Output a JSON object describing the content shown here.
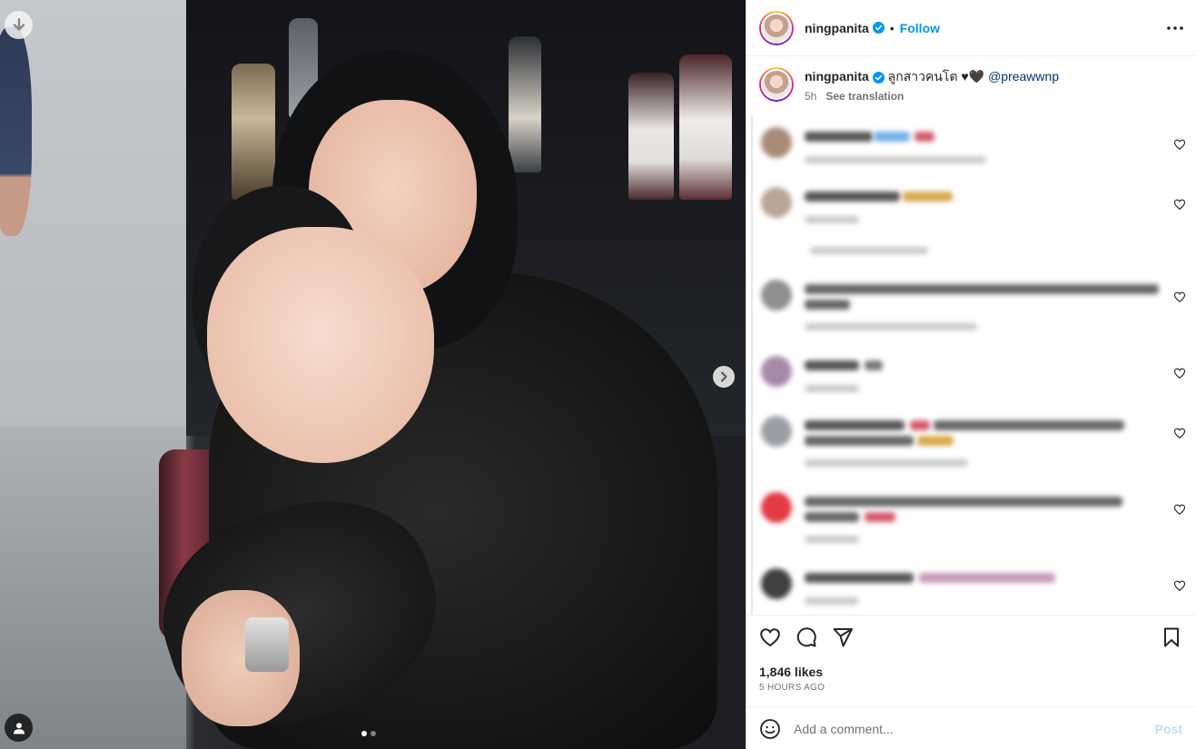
{
  "post": {
    "image_alt": "",
    "carousel": {
      "slide_count": 2,
      "active_index": 0
    },
    "icons": {
      "download": "download-arrow-icon",
      "user_tags": "user-tag-icon",
      "next": "chevron-right-icon"
    }
  },
  "header": {
    "username": "ningpanita",
    "verified": true,
    "separator": "•",
    "follow_label": "Follow",
    "more_icon": "more-options-icon"
  },
  "caption": {
    "username": "ningpanita",
    "text": "ลูกสาวคนโต ♥🖤",
    "mention": "@preawwnp",
    "time": "5h",
    "see_translation": "See translation"
  },
  "comments": {
    "blurred": true,
    "count_visible": 8
  },
  "actions": {
    "like_icon": "heart-icon",
    "comment_icon": "comment-icon",
    "share_icon": "share-icon",
    "save_icon": "bookmark-icon",
    "likes": "1,846 likes",
    "time": "5 HOURS AGO"
  },
  "add_comment": {
    "placeholder": "Add a comment...",
    "post_label": "Post",
    "emoji_icon": "emoji-icon"
  },
  "colors": {
    "link": "#0095f6",
    "mention": "#00376b",
    "muted": "#737373",
    "post_disabled": "#b2dffc"
  }
}
